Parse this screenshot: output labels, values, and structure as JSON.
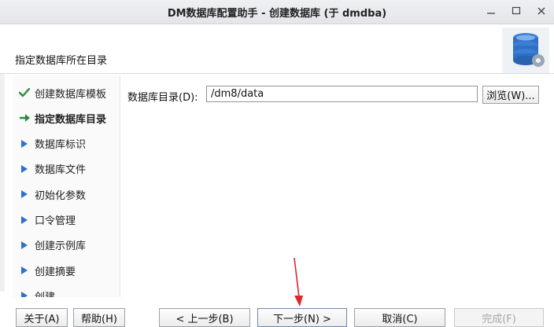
{
  "window": {
    "title": "DM数据库配置助手 - 创建数据库 (于 dmdba)"
  },
  "header": {
    "subtitle": "指定数据库所在目录",
    "logo_icon": "database-config-icon"
  },
  "nav": {
    "items": [
      {
        "label": "创建数据库模板",
        "state": "done",
        "icon": "check-icon"
      },
      {
        "label": "指定数据库目录",
        "state": "current",
        "icon": "arrow-right-icon"
      },
      {
        "label": "数据库标识",
        "state": "pending",
        "icon": "triangle-right-icon"
      },
      {
        "label": "数据库文件",
        "state": "pending",
        "icon": "triangle-right-icon"
      },
      {
        "label": "初始化参数",
        "state": "pending",
        "icon": "triangle-right-icon"
      },
      {
        "label": "口令管理",
        "state": "pending",
        "icon": "triangle-right-icon"
      },
      {
        "label": "创建示例库",
        "state": "pending",
        "icon": "triangle-right-icon"
      },
      {
        "label": "创建摘要",
        "state": "pending",
        "icon": "triangle-right-icon"
      },
      {
        "label": "创建",
        "state": "pending",
        "icon": "triangle-right-icon"
      }
    ]
  },
  "content": {
    "dir_label": "数据库目录(D):",
    "dir_value": "/dm8/data",
    "browse_label": "浏览(W)..."
  },
  "footer": {
    "about": "关于(A)",
    "help": "帮助(H)",
    "prev": "< 上一步(B)",
    "next": "下一步(N) >",
    "cancel": "取消(C)",
    "finish": "完成(F)"
  },
  "colors": {
    "check": "#2e8b3d",
    "arrow": "#2e8b3d",
    "triangle": "#2f6fd0",
    "annotation": "#e0262b"
  }
}
